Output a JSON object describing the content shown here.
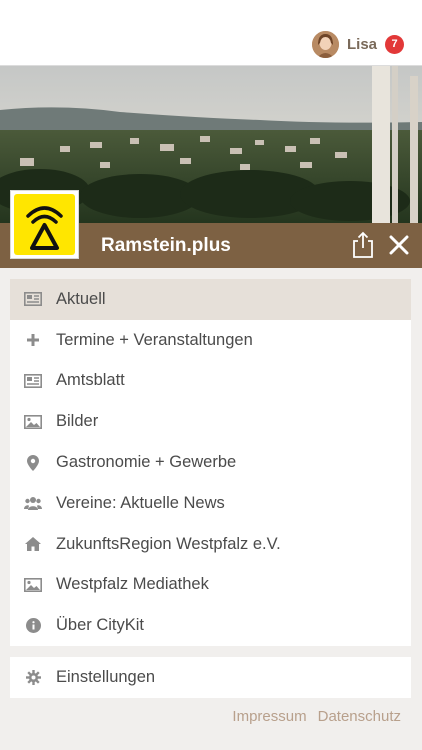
{
  "user": {
    "name": "Lisa",
    "notifications": "7"
  },
  "header": {
    "title": "Ramstein.plus"
  },
  "menu": {
    "items": [
      {
        "label": "Aktuell",
        "icon": "newspaper-icon",
        "active": true
      },
      {
        "label": "Termine + Veranstaltungen",
        "icon": "plus-icon"
      },
      {
        "label": "Amtsblatt",
        "icon": "newspaper-icon"
      },
      {
        "label": "Bilder",
        "icon": "image-icon"
      },
      {
        "label": "Gastronomie + Gewerbe",
        "icon": "map-pin-icon"
      },
      {
        "label": "Vereine: Aktuelle News",
        "icon": "users-icon"
      },
      {
        "label": "ZukunftsRegion Westpfalz e.V.",
        "icon": "home-icon"
      },
      {
        "label": "Westpfalz Mediathek",
        "icon": "image-icon"
      },
      {
        "label": "Über CityKit",
        "icon": "info-icon"
      }
    ]
  },
  "settings": {
    "label": "Einstellungen",
    "icon": "gear-icon"
  },
  "footer": {
    "impressum": "Impressum",
    "datenschutz": "Datenschutz"
  },
  "colors": {
    "brand": "#7d6143",
    "active_bg": "#e6e0d9",
    "badge": "#e23838",
    "logo_yellow": "#ffe600",
    "link": "#b8a08c"
  }
}
